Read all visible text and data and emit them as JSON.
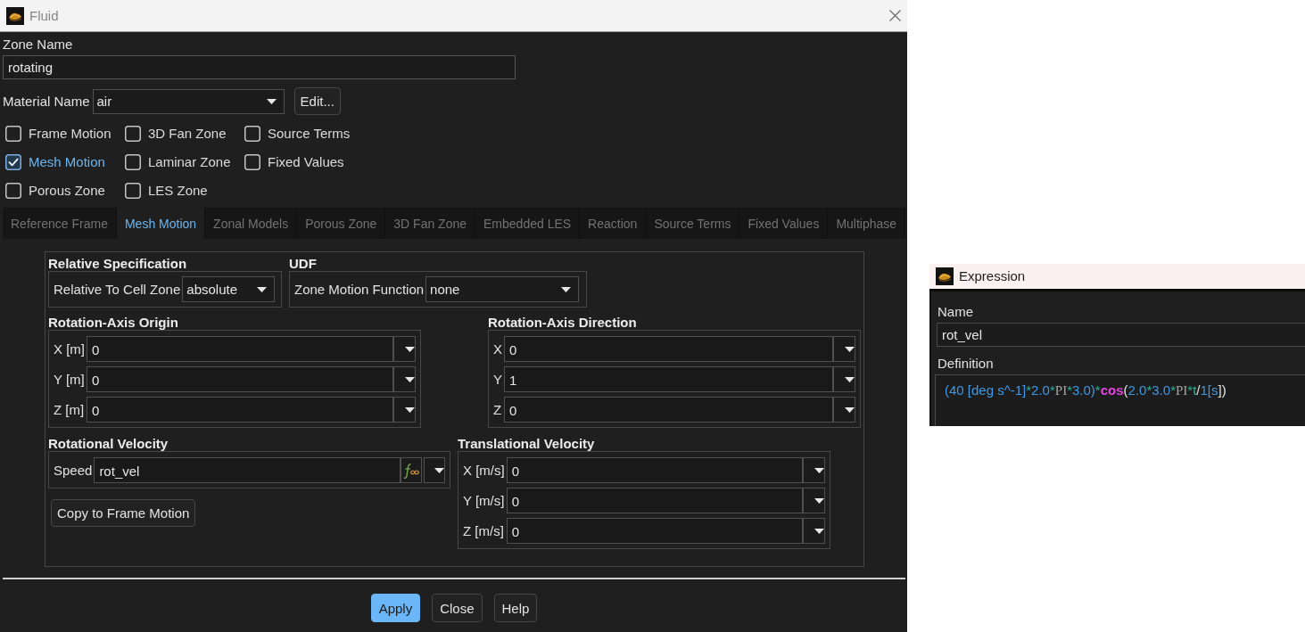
{
  "fluid_window": {
    "title": "Fluid",
    "zone_name": {
      "label": "Zone Name",
      "value": "rotating"
    },
    "material": {
      "label": "Material Name",
      "value": "air",
      "button": "Edit..."
    },
    "options": [
      {
        "label": "Frame Motion",
        "checked": false
      },
      {
        "label": "3D Fan Zone",
        "checked": false
      },
      {
        "label": "Source Terms",
        "checked": false
      },
      {
        "label": "Mesh Motion",
        "checked": true
      },
      {
        "label": "Laminar Zone",
        "checked": false
      },
      {
        "label": "Fixed Values",
        "checked": false
      },
      {
        "label": "Porous Zone",
        "checked": false
      },
      {
        "label": "LES Zone",
        "checked": false
      }
    ],
    "tabs": [
      {
        "label": "Reference Frame",
        "selected": false
      },
      {
        "label": "Mesh Motion",
        "selected": true
      },
      {
        "label": "Zonal Models",
        "selected": false
      },
      {
        "label": "Porous Zone",
        "selected": false
      },
      {
        "label": "3D Fan Zone",
        "selected": false
      },
      {
        "label": "Embedded LES",
        "selected": false
      },
      {
        "label": "Reaction",
        "selected": false
      },
      {
        "label": "Source Terms",
        "selected": false
      },
      {
        "label": "Fixed Values",
        "selected": false
      },
      {
        "label": "Multiphase",
        "selected": false
      }
    ],
    "mesh_motion": {
      "relative_specification": {
        "title": "Relative Specification",
        "label": "Relative To Cell Zone",
        "value": "absolute"
      },
      "udf": {
        "title": "UDF",
        "label": "Zone Motion Function",
        "value": "none"
      },
      "rotation_axis_origin": {
        "title": "Rotation-Axis Origin",
        "rows": [
          {
            "label": "X [m]",
            "value": "0"
          },
          {
            "label": "Y [m]",
            "value": "0"
          },
          {
            "label": "Z [m]",
            "value": "0"
          }
        ]
      },
      "rotation_axis_direction": {
        "title": "Rotation-Axis Direction",
        "rows": [
          {
            "label": "X",
            "value": "0"
          },
          {
            "label": "Y",
            "value": "1"
          },
          {
            "label": "Z",
            "value": "0"
          }
        ]
      },
      "rotational_velocity": {
        "title": "Rotational Velocity",
        "label": "Speed",
        "value": "rot_vel",
        "button": "Copy to Frame Motion"
      },
      "translational_velocity": {
        "title": "Translational Velocity",
        "rows": [
          {
            "label": "X [m/s]",
            "value": "0"
          },
          {
            "label": "Y [m/s]",
            "value": "0"
          },
          {
            "label": "Z [m/s]",
            "value": "0"
          }
        ]
      }
    },
    "buttons": [
      {
        "label": "Apply",
        "primary": true
      },
      {
        "label": "Close",
        "primary": false
      },
      {
        "label": "Help",
        "primary": false
      }
    ]
  },
  "expression_window": {
    "title": "Expression",
    "name": {
      "label": "Name",
      "value": "rot_vel"
    },
    "definition": {
      "label": "Definition",
      "tokens": [
        {
          "text": "(40 [deg s^-1]",
          "kind": "number"
        },
        {
          "text": "*",
          "kind": "operator"
        },
        {
          "text": "2.0",
          "kind": "number"
        },
        {
          "text": "*",
          "kind": "operator"
        },
        {
          "text": "PI",
          "kind": "constant"
        },
        {
          "text": "*",
          "kind": "operator"
        },
        {
          "text": "3.0)",
          "kind": "number"
        },
        {
          "text": "*",
          "kind": "operator"
        },
        {
          "text": "cos",
          "kind": "function"
        },
        {
          "text": "(",
          "kind": "plain"
        },
        {
          "text": "2.0",
          "kind": "number"
        },
        {
          "text": "*",
          "kind": "operator"
        },
        {
          "text": "3.0",
          "kind": "number"
        },
        {
          "text": "*",
          "kind": "operator"
        },
        {
          "text": "PI",
          "kind": "constant"
        },
        {
          "text": "*",
          "kind": "operator"
        },
        {
          "text": "t",
          "kind": "variable"
        },
        {
          "text": "/",
          "kind": "plain"
        },
        {
          "text": "1[s",
          "kind": "number"
        },
        {
          "text": "])",
          "kind": "plain"
        }
      ]
    }
  }
}
